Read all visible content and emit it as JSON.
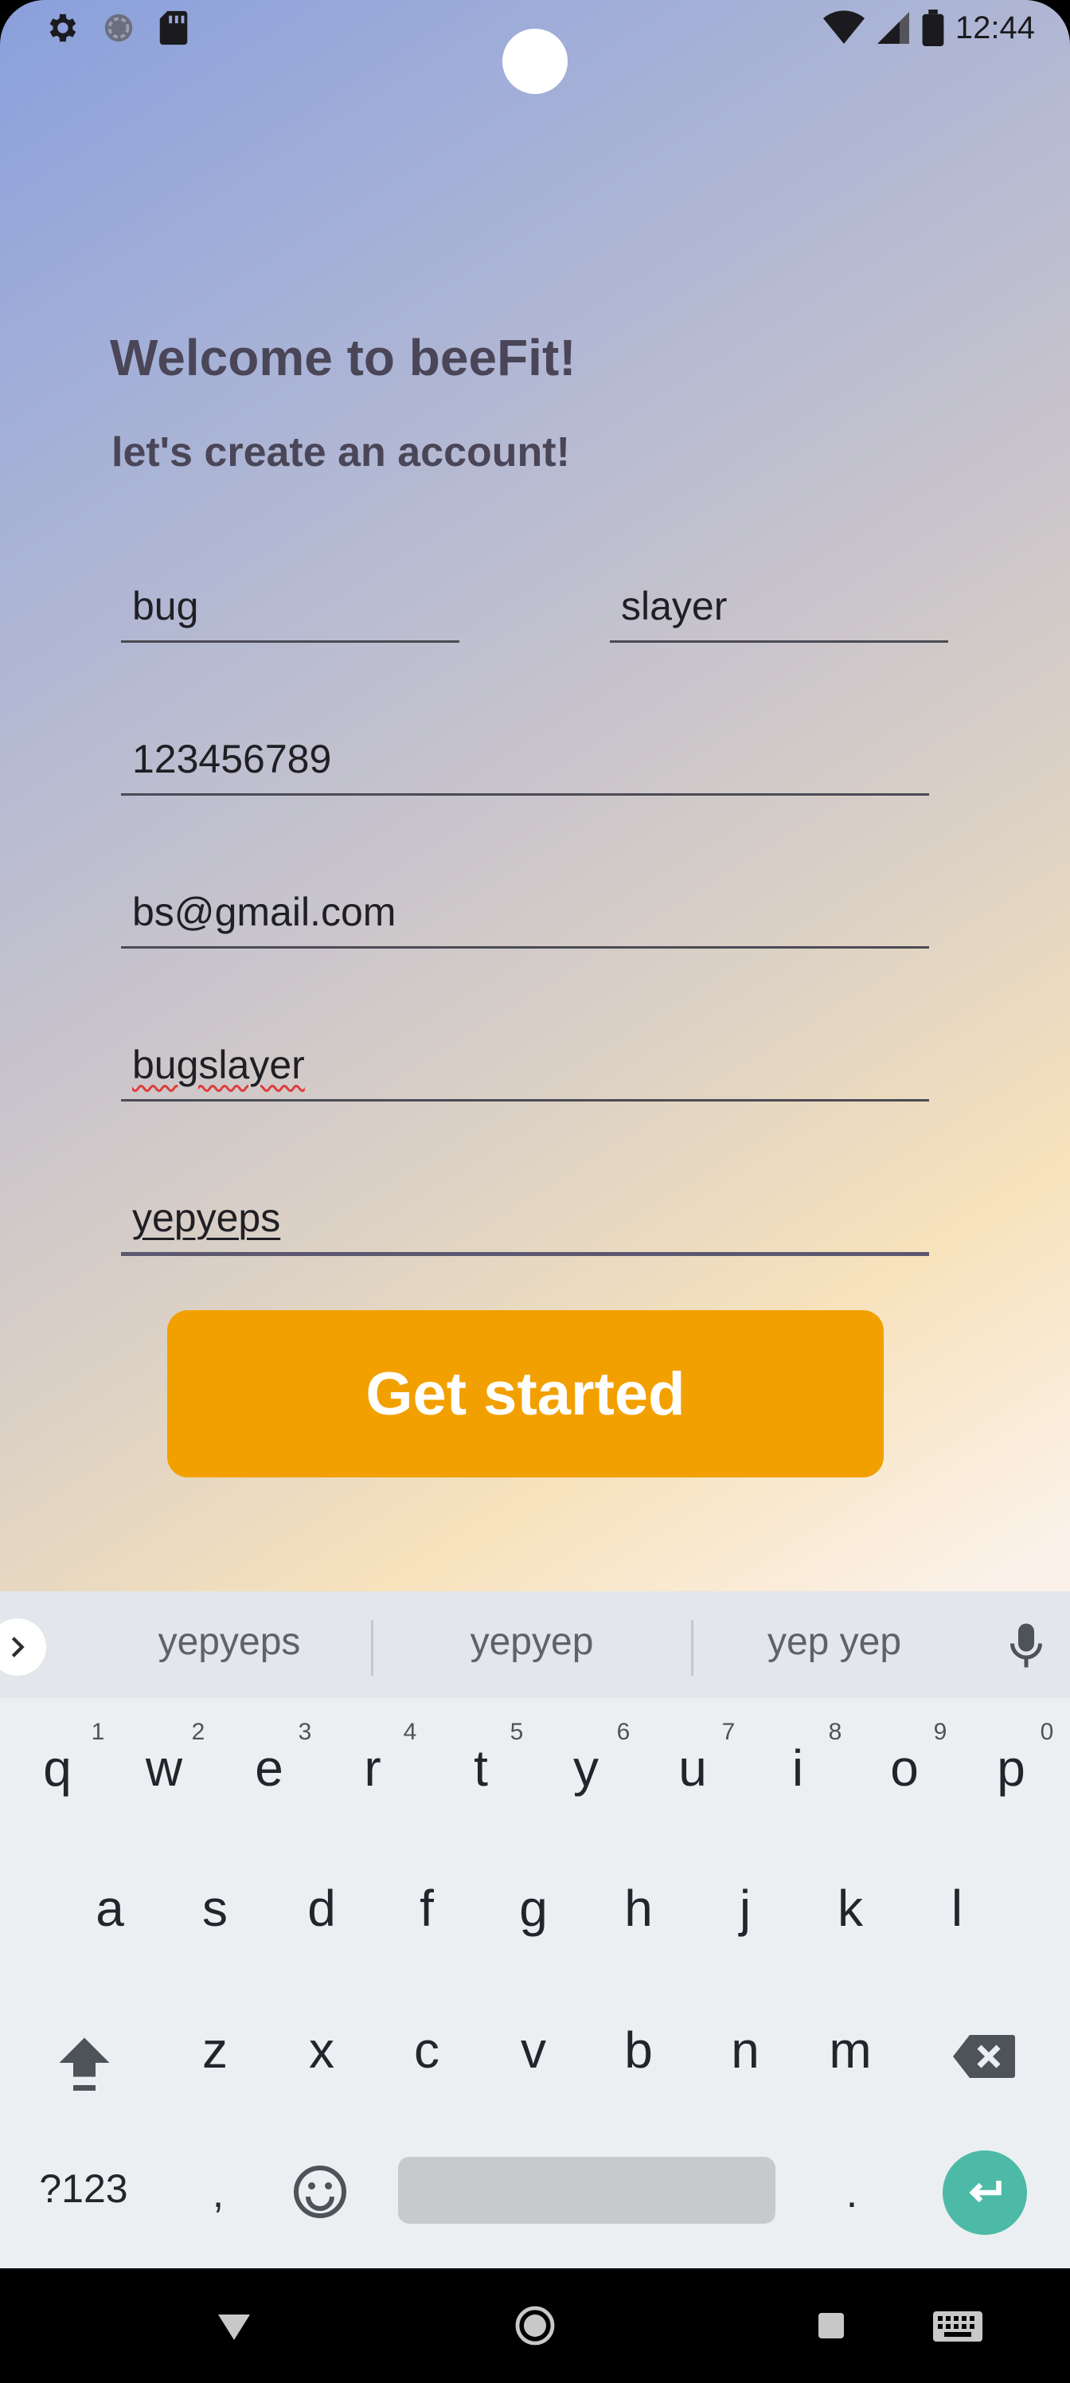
{
  "status_bar": {
    "time": "12:44",
    "icons_left": [
      "gear-icon",
      "sync-icon",
      "sd-card-icon"
    ],
    "icons_right": [
      "wifi-icon",
      "signal-icon",
      "battery-icon"
    ]
  },
  "app": {
    "title": "Welcome to beeFit!",
    "subtitle": "let's create an account!",
    "fields": {
      "first_name": "bug",
      "last_name": "slayer",
      "phone": "123456789",
      "email": "bs@gmail.com",
      "username": "bugslayer",
      "password": "yepyeps"
    },
    "primary_button": "Get started",
    "accent_color": "#f2a000"
  },
  "keyboard": {
    "suggestions": [
      "yepyeps",
      "yepyep",
      "yep yep"
    ],
    "row1": [
      "q",
      "w",
      "e",
      "r",
      "t",
      "y",
      "u",
      "i",
      "o",
      "p"
    ],
    "row1_hints": [
      "1",
      "2",
      "3",
      "4",
      "5",
      "6",
      "7",
      "8",
      "9",
      "0"
    ],
    "row2": [
      "a",
      "s",
      "d",
      "f",
      "g",
      "h",
      "j",
      "k",
      "l"
    ],
    "row3": [
      "z",
      "x",
      "c",
      "v",
      "b",
      "n",
      "m"
    ],
    "row4": {
      "symbols": "?123",
      "comma": ",",
      "period": "."
    },
    "enter_color": "#4cbaa7"
  }
}
